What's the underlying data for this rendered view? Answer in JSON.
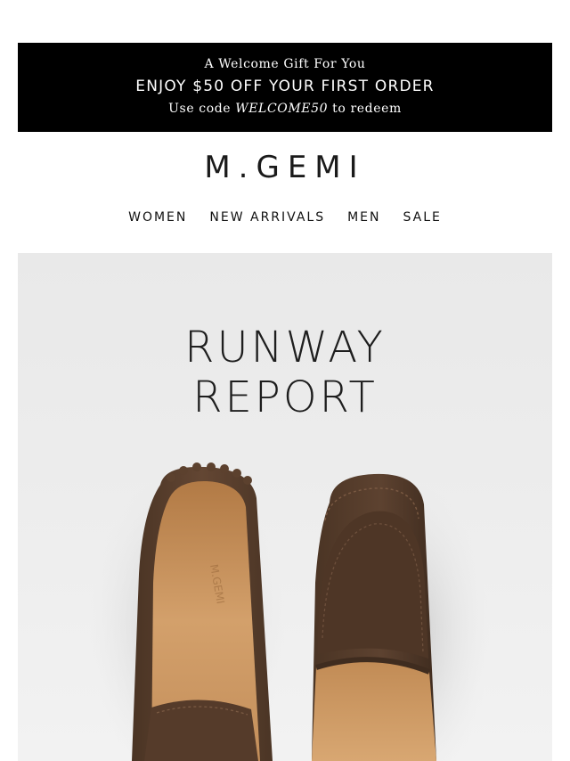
{
  "promo": {
    "eyebrow": "A Welcome Gift For You",
    "headline": "ENJOY $50 OFF YOUR FIRST ORDER",
    "code_prefix": "Use code ",
    "code": "WELCOME50",
    "code_suffix": " to redeem"
  },
  "brand": {
    "logo_text": "M.GEMI"
  },
  "nav": {
    "items": [
      {
        "label": "WOMEN"
      },
      {
        "label": "NEW ARRIVALS"
      },
      {
        "label": "MEN"
      },
      {
        "label": "SALE"
      }
    ]
  },
  "hero": {
    "title_line1": "RUNWAY",
    "title_line2": "REPORT",
    "image": "brown-suede-driving-loafers"
  },
  "colors": {
    "banner_bg": "#000000",
    "banner_text": "#ffffff",
    "text": "#111111",
    "hero_bg": "#ececec",
    "suede": "#5a4130",
    "leather_lining": "#c9935a"
  }
}
